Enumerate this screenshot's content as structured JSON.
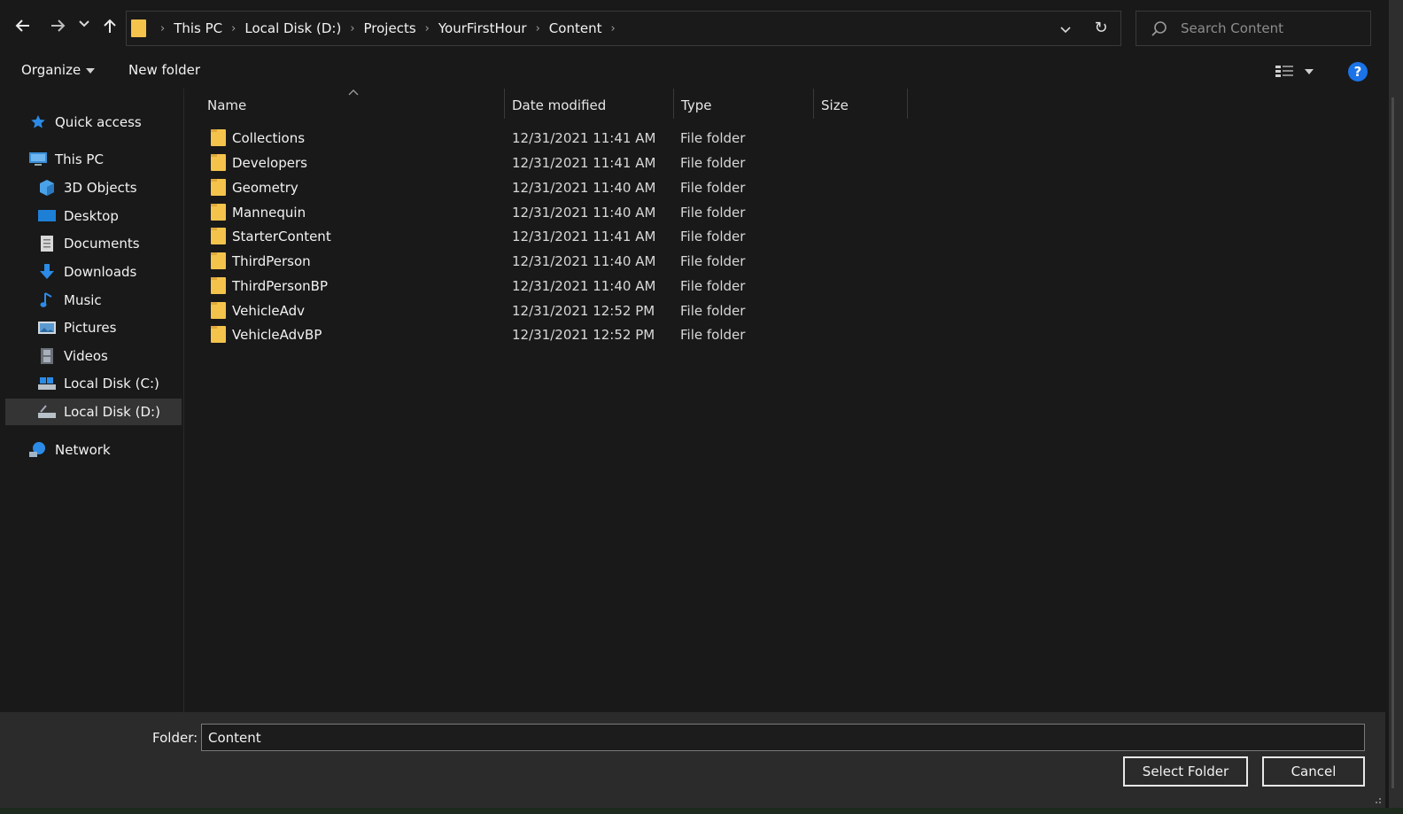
{
  "address_bar": {
    "breadcrumbs": [
      "This PC",
      "Local Disk (D:)",
      "Projects",
      "YourFirstHour",
      "Content"
    ]
  },
  "search": {
    "placeholder": "Search Content"
  },
  "toolbar": {
    "organize_label": "Organize",
    "new_folder_label": "New folder"
  },
  "nav_pane": {
    "quick_access": "Quick access",
    "this_pc": "This PC",
    "items": [
      "3D Objects",
      "Desktop",
      "Documents",
      "Downloads",
      "Music",
      "Pictures",
      "Videos",
      "Local Disk (C:)",
      "Local Disk (D:)"
    ],
    "selected": "Local Disk (D:)",
    "network": "Network"
  },
  "columns": {
    "name": "Name",
    "date_modified": "Date modified",
    "type": "Type",
    "size": "Size"
  },
  "files": [
    {
      "name": "Collections",
      "date": "12/31/2021 11:41 AM",
      "type": "File folder"
    },
    {
      "name": "Developers",
      "date": "12/31/2021 11:41 AM",
      "type": "File folder"
    },
    {
      "name": "Geometry",
      "date": "12/31/2021 11:40 AM",
      "type": "File folder"
    },
    {
      "name": "Mannequin",
      "date": "12/31/2021 11:40 AM",
      "type": "File folder"
    },
    {
      "name": "StarterContent",
      "date": "12/31/2021 11:41 AM",
      "type": "File folder"
    },
    {
      "name": "ThirdPerson",
      "date": "12/31/2021 11:40 AM",
      "type": "File folder"
    },
    {
      "name": "ThirdPersonBP",
      "date": "12/31/2021 11:40 AM",
      "type": "File folder"
    },
    {
      "name": "VehicleAdv",
      "date": "12/31/2021 12:52 PM",
      "type": "File folder"
    },
    {
      "name": "VehicleAdvBP",
      "date": "12/31/2021 12:52 PM",
      "type": "File folder"
    }
  ],
  "bottom": {
    "folder_label": "Folder:",
    "folder_value": "Content",
    "select_button": "Select Folder",
    "cancel_button": "Cancel"
  },
  "help_label": "?",
  "colors": {
    "background": "#191919",
    "bottom_panel": "#2b2b2b",
    "folder_icon": "#f4c34b",
    "accent": "#1a73e8",
    "selection": "#343434"
  }
}
